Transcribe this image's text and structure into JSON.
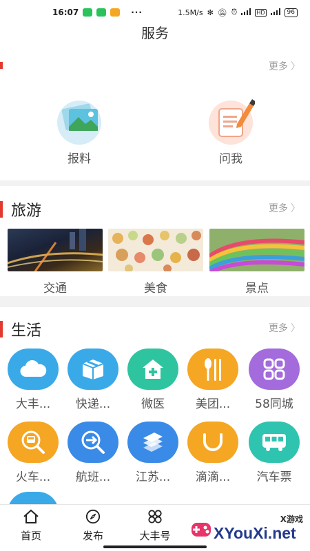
{
  "status_bar": {
    "time": "16:07",
    "dots": "···",
    "speed": "1.5M/s",
    "battery": "96"
  },
  "header": {
    "title": "服务"
  },
  "service_section": {
    "more": "更多",
    "items": [
      {
        "label": "报料",
        "icon": "photo-gallery-icon"
      },
      {
        "label": "问我",
        "icon": "notepad-pencil-icon"
      }
    ]
  },
  "tourism": {
    "title": "旅游",
    "more": "更多",
    "items": [
      {
        "label": "交通"
      },
      {
        "label": "美食"
      },
      {
        "label": "景点"
      }
    ]
  },
  "life": {
    "title": "生活",
    "more": "更多",
    "items": [
      {
        "label": "大丰...",
        "icon": "cloud-icon",
        "color": "#3aa9e8"
      },
      {
        "label": "快递...",
        "icon": "package-box-icon",
        "color": "#3aa9e8"
      },
      {
        "label": "微医",
        "icon": "medical-house-icon",
        "color": "#2fc4a0"
      },
      {
        "label": "美团...",
        "icon": "spoon-fork-icon",
        "color": "#f5a623"
      },
      {
        "label": "58同城",
        "icon": "grid-apps-icon",
        "color": "#a36bdc"
      },
      {
        "label": "火车...",
        "icon": "train-search-icon",
        "color": "#f5a623"
      },
      {
        "label": "航班...",
        "icon": "flight-search-icon",
        "color": "#3a8ae8"
      },
      {
        "label": "江苏...",
        "icon": "china-mobile-icon",
        "color": "#3a8ae8"
      },
      {
        "label": "滴滴...",
        "icon": "didi-icon",
        "color": "#f5a623"
      },
      {
        "label": "汽车票",
        "icon": "bus-icon",
        "color": "#2fc4b0"
      }
    ]
  },
  "bottom_nav": {
    "items": [
      {
        "label": "首页",
        "icon": "home-icon"
      },
      {
        "label": "发布",
        "icon": "compass-icon"
      },
      {
        "label": "大丰号",
        "icon": "four-circles-icon"
      }
    ]
  },
  "watermark": {
    "top": "X游戏",
    "main": "XYouXi.net"
  }
}
